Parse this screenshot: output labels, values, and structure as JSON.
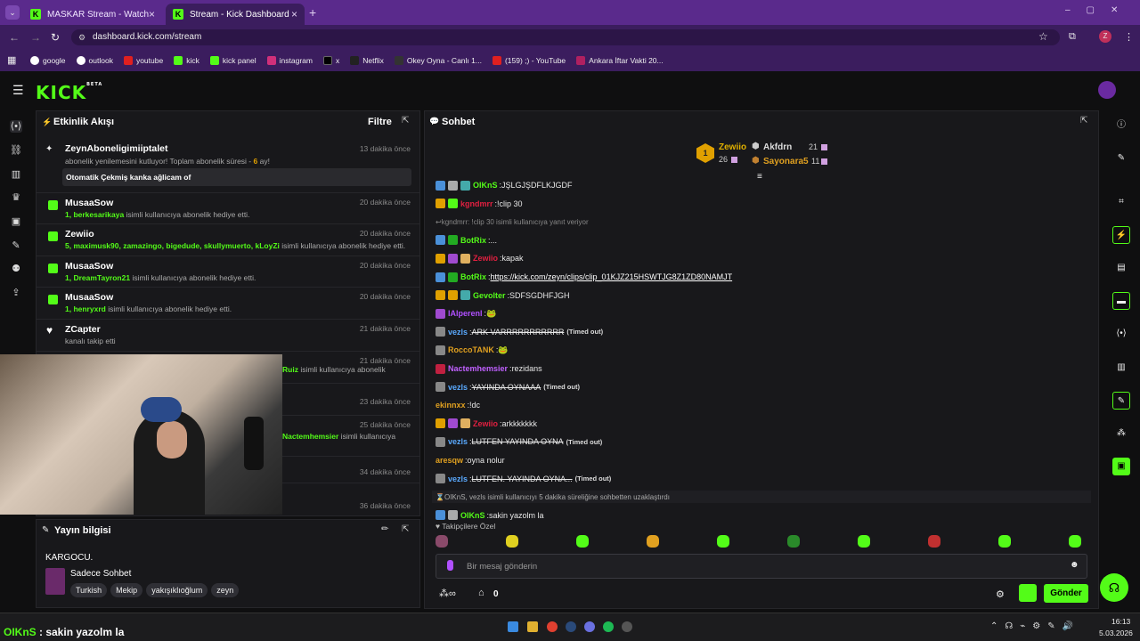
{
  "browser": {
    "tabs": [
      {
        "label": "MASKAR Stream - Watch Live o"
      },
      {
        "label": "Stream - Kick Dashboard"
      }
    ],
    "url": "dashboard.kick.com/stream",
    "bookmarks": [
      "google",
      "outlook",
      "youtube",
      "kick",
      "kick panel",
      "instagram",
      "x",
      "Netflix",
      "Okey Oyna - Canlı 1...",
      "(159) ;) - YouTube",
      "Ankara İftar Vakti 20..."
    ]
  },
  "kick": {
    "logo": "KICK",
    "beta": "BETA"
  },
  "feed": {
    "title": "Etkinlik Akışı",
    "filter": "Filtre",
    "items": [
      {
        "name": "ZeynAboneligimiiptalet",
        "desc": "abonelik yenilemesini kutluyor! Toplam abonelik süresi - ",
        "months": "6",
        "suffix": " ay!",
        "msg": "Otomatik Çekmiş kanka ağlicam of",
        "time": "13 dakika önce"
      },
      {
        "name": "MusaaSow",
        "users": "1, berkesarikaya",
        "desc": " isimli kullanıcıya abonelik hediye etti.",
        "time": "20 dakika önce"
      },
      {
        "name": "Zewiio",
        "users": "5, maximusk90, zamazingo, bigedude, skullymuerto, kLoyZi",
        "desc": " isimli kullanıcıya abonelik hediye etti.",
        "time": "20 dakika önce"
      },
      {
        "name": "MusaaSow",
        "users": "1, DreamTayron21",
        "desc": " isimli kullanıcıya abonelik hediye etti.",
        "time": "20 dakika önce"
      },
      {
        "name": "MusaaSow",
        "users": "1, henryxrd",
        "desc": " isimli kullanıcıya abonelik hediye etti.",
        "time": "20 dakika önce"
      },
      {
        "name": "ZCapter",
        "desc": "kanalı takip etti",
        "time": "21 dakika önce"
      },
      {
        "partial_user": "Ruiz",
        "desc": " isimli kullanıcıya abonelik",
        "time": "21 dakika önce"
      },
      {
        "time": "23 dakika önce"
      },
      {
        "partial_user": "Nactemhemsier",
        "desc": " isimli kullanıcıya",
        "time": "25 dakika önce"
      },
      {
        "time": "34 dakika önce"
      },
      {
        "time": "36 dakika önce"
      }
    ]
  },
  "info": {
    "title": "Yayın bilgisi",
    "stream_title": "KARGOCU.",
    "category": "Sadece Sohbet",
    "tags": [
      "Turkish",
      "Mekip",
      "yakışıklıoğlum",
      "zeyn"
    ]
  },
  "chat": {
    "title": "Sohbet",
    "leaders": [
      {
        "rank": "1",
        "name": "Zewiio",
        "count": "26"
      },
      {
        "name": "Akfdrn",
        "count": "21"
      },
      {
        "name": "Sayonara5",
        "count": "11"
      }
    ],
    "messages": [
      {
        "user": "OIKnS",
        "text": "JŞLGJŞDFLKJGDF",
        "ucolor": "#53fc18",
        "badges": [
          "#4a90d9",
          "#aaa",
          "#4aa"
        ]
      },
      {
        "user": "kgndmrr",
        "text": "!clip 30",
        "ucolor": "#e02040",
        "badges": [
          "#e0a000",
          "#53fc18"
        ]
      },
      {
        "reply": "kgndmrr: !clip 30 isimli kullanıcıya yanıt veriyor"
      },
      {
        "user": "BotRix",
        "text": "...",
        "ucolor": "#53fc18",
        "badges": [
          "#4a90d9",
          "#2a2"
        ]
      },
      {
        "user": "Zewiio",
        "text": "kapak",
        "ucolor": "#e02040",
        "badges": [
          "#e0a000",
          "#a04ad0",
          "#e0b060"
        ]
      },
      {
        "user": "BotRix",
        "text": "https://kick.com/zeyn/clips/clip_01KJZ215HSWTJG8Z1ZD80NAMJT",
        "ucolor": "#53fc18",
        "badges": [
          "#4a90d9",
          "#2a2"
        ],
        "link": true
      },
      {
        "user": "Gevolter",
        "text": "SDFSGDHFJGH",
        "ucolor": "#53fc18",
        "badges": [
          "#e0a000",
          "#e0a000",
          "#4aa"
        ]
      },
      {
        "user": "lAlperenl",
        "text": "🐸",
        "ucolor": "#b050ff",
        "badges": [
          "#a04ad0"
        ]
      },
      {
        "user": "vezls",
        "text": "ARK VARRRRRRRRRRR",
        "ucolor": "#5aaaff",
        "badges": [
          "#888"
        ],
        "timeout": "(Timed out)"
      },
      {
        "user": "RoccoTANK",
        "text": "🐸",
        "ucolor": "#e0a020",
        "badges": [
          "#888"
        ]
      },
      {
        "user": "Nactemhemsier",
        "text": "rezidans",
        "ucolor": "#c060ff",
        "badges": [
          "#c02040"
        ]
      },
      {
        "user": "vezls",
        "text": "YAYINDA OYNAAA",
        "ucolor": "#5aaaff",
        "badges": [
          "#888"
        ],
        "timeout": "(Timed out)"
      },
      {
        "user": "ekinnxx",
        "text": "!dc",
        "ucolor": "#e0a020",
        "badges": []
      },
      {
        "user": "Zewiio",
        "text": "arkkkkkkk",
        "ucolor": "#e02040",
        "badges": [
          "#e0a000",
          "#a04ad0",
          "#e0b060"
        ]
      },
      {
        "user": "vezls",
        "text": "LUTFEN YAYINDA OYNA",
        "ucolor": "#5aaaff",
        "badges": [
          "#888"
        ],
        "timeout": "(Timed out)"
      },
      {
        "user": "aresqw",
        "text": "oyna nolur",
        "ucolor": "#e0a020",
        "badges": []
      },
      {
        "user": "vezls",
        "text": "LUTFEN. YAYINDA OYNA...",
        "ucolor": "#5aaaff",
        "badges": [
          "#888"
        ],
        "timeout": "(Timed out)"
      },
      {
        "system": "OIKnS, vezls isimli kullanıcıyı 5 dakika süreliğine sohbetten uzaklaştırdı"
      },
      {
        "user": "OIKnS",
        "text": "sakin yazolm la",
        "ucolor": "#53fc18",
        "badges": [
          "#4a90d9",
          "#aaa"
        ]
      }
    ],
    "emote_label": "Takipçilere Özel",
    "placeholder": "Bir mesaj gönderin",
    "send": "Gönder",
    "points": "0"
  },
  "overlay_text": {
    "user": "OIKnS",
    "text": " : sakin yazolm la"
  },
  "clock": {
    "time": "16:13",
    "date": "5.03.2026"
  }
}
